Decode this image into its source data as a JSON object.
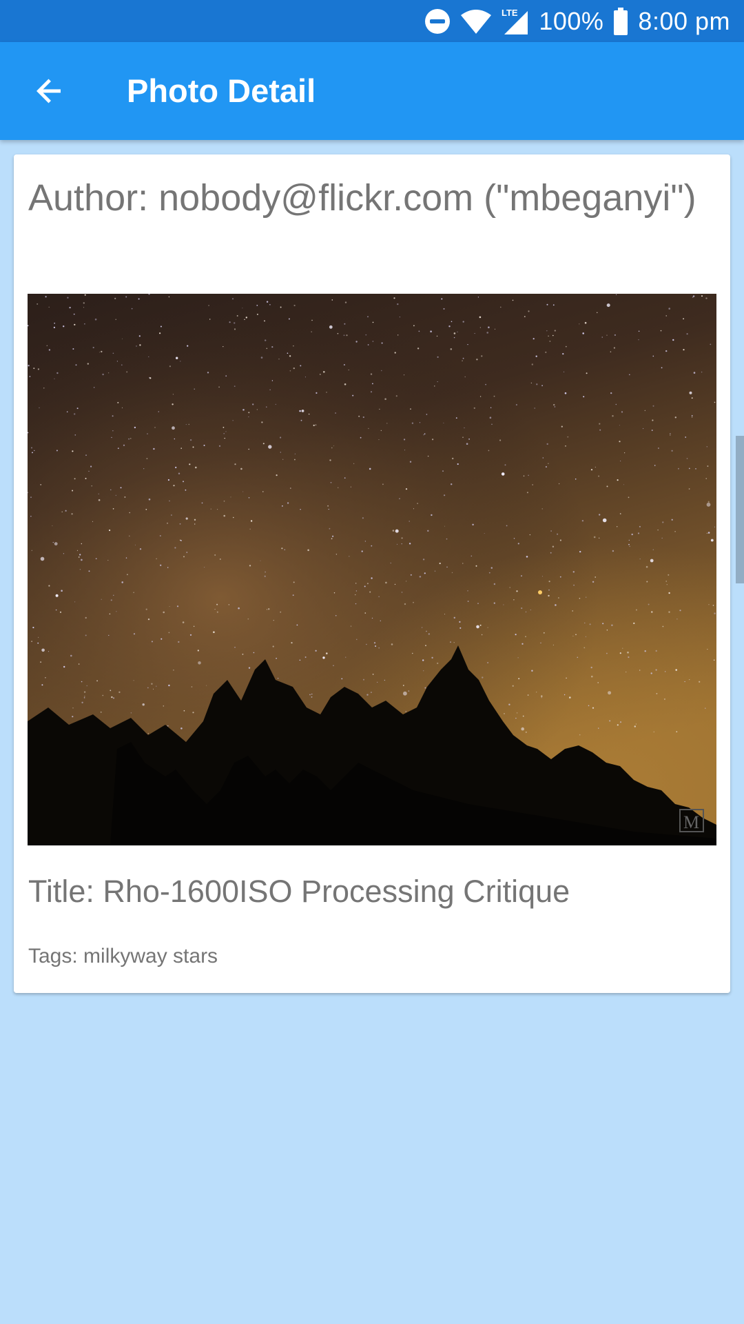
{
  "status_bar": {
    "battery": "100%",
    "time": "8:00 pm",
    "network": "LTE",
    "icons": [
      "do-not-disturb-icon",
      "wifi-icon",
      "signal-icon",
      "battery-icon"
    ]
  },
  "app_bar": {
    "title": "Photo Detail",
    "back_icon": "arrow-back-icon"
  },
  "photo": {
    "author": "Author: nobody@flickr.com (\"mbeganyi\")",
    "title": "Title: Rho-1600ISO Processing Critique",
    "tags": "Tags: milkyway stars",
    "watermark_glyph": "M"
  },
  "colors": {
    "status_bar": "#1976d2",
    "app_bar": "#2196f3",
    "background": "#bbdefb",
    "card": "#ffffff",
    "text_secondary": "#757575"
  }
}
